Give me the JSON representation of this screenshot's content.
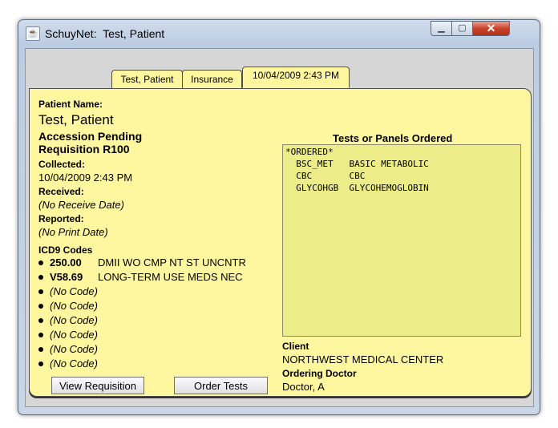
{
  "window": {
    "title": "SchuyNet:  Test, Patient",
    "app_icon": "java-cup-icon",
    "controls": {
      "minimize": "minimize-icon",
      "maximize": "maximize-icon",
      "close": "close-icon"
    }
  },
  "tabs": [
    {
      "label": "Test, Patient",
      "selected": false
    },
    {
      "label": "Insurance",
      "selected": false
    },
    {
      "label": "10/04/2009  2:43 PM",
      "selected": true
    }
  ],
  "patient": {
    "name_label": "Patient Name:",
    "name": "Test, Patient",
    "status": "Accession Pending",
    "requisition": "Requisition R100",
    "collected_label": "Collected:",
    "collected": "10/04/2009 2:43 PM",
    "received_label": "Received:",
    "received": "(No Receive Date)",
    "reported_label": "Reported:",
    "reported": "(No Print Date)"
  },
  "icd9": {
    "label": "ICD9 Codes",
    "codes": [
      {
        "code": "250.00",
        "desc": "DMII WO CMP NT ST UNCNTR"
      },
      {
        "code": "V58.69",
        "desc": "LONG-TERM USE MEDS NEC"
      },
      {
        "code": "(No Code)"
      },
      {
        "code": "(No Code)"
      },
      {
        "code": "(No Code)"
      },
      {
        "code": "(No Code)"
      },
      {
        "code": "(No Code)"
      },
      {
        "code": "(No Code)"
      }
    ]
  },
  "buttons": {
    "view_requisition": "View Requisition",
    "order_tests": "Order Tests"
  },
  "tests": {
    "title": "Tests or Panels Ordered",
    "lines": [
      "*ORDERED*",
      "  BSC_MET   BASIC METABOLIC",
      "  CBC       CBC",
      "  GLYCOHGB  GLYCOHEMOGLOBIN"
    ]
  },
  "client": {
    "label": "Client",
    "name": "NORTHWEST MEDICAL CENTER"
  },
  "doctor": {
    "label": "Ordering Doctor",
    "name": "Doctor, A"
  }
}
